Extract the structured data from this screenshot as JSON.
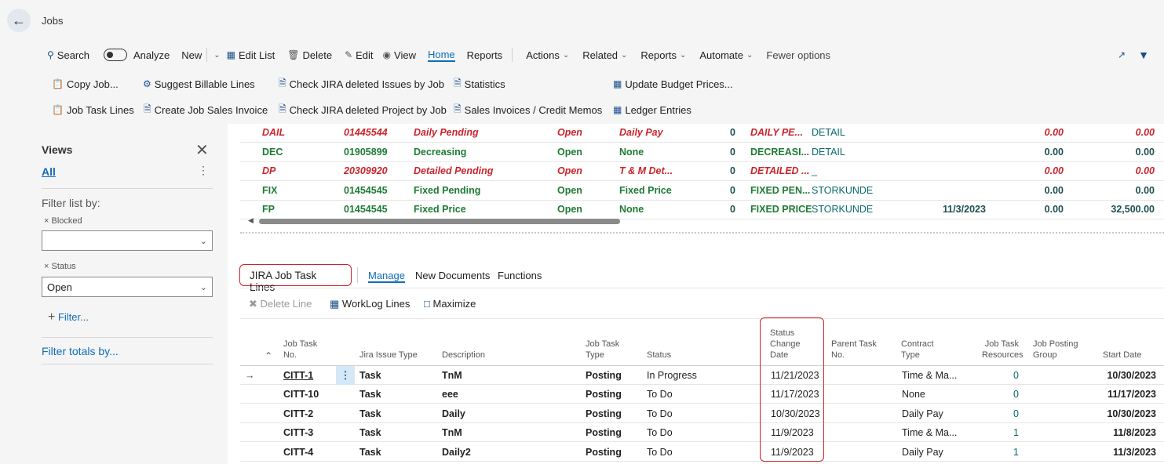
{
  "header": {
    "title": "Jobs",
    "back_icon": "arrow-left-icon"
  },
  "actionbar": {
    "row1": {
      "search": "Search",
      "analyze": "Analyze",
      "new": "New",
      "edit_list": "Edit List",
      "delete": "Delete",
      "edit": "Edit",
      "view": "View",
      "home": "Home",
      "reports": "Reports",
      "actions": "Actions",
      "related": "Related",
      "reports2": "Reports",
      "automate": "Automate",
      "fewer_options": "Fewer options"
    },
    "row2": {
      "copy_job": "Copy Job...",
      "suggest_billable": "Suggest Billable Lines",
      "check_jira_issues": "Check JIRA deleted Issues by Job",
      "statistics": "Statistics",
      "update_budget": "Update Budget Prices..."
    },
    "row3": {
      "job_task_lines": "Job Task Lines",
      "create_sales_invoice": "Create Job Sales Invoice",
      "check_jira_project": "Check JIRA deleted Project by Job",
      "sales_invoices": "Sales Invoices / Credit Memos",
      "ledger_entries": "Ledger Entries"
    }
  },
  "views": {
    "title": "Views",
    "all": "All",
    "filter_by": "Filter list by:",
    "blocked_label": "Blocked",
    "blocked_value": "",
    "status_label": "Status",
    "status_value": "Open",
    "add_filter": "Filter...",
    "filter_totals": "Filter totals by..."
  },
  "top_rows": [
    {
      "code": "DAIL",
      "num": "01445544",
      "desc": "Daily Pending",
      "status": "Open",
      "contract": "Daily Pay",
      "zero": "0",
      "desc2": "DAILY PE...",
      "cust": "DETAIL",
      "date": "",
      "v1": "0.00",
      "v2": "0.00",
      "style": "red"
    },
    {
      "code": "DEC",
      "num": "01905899",
      "desc": "Decreasing",
      "status": "Open",
      "contract": "None",
      "zero": "0",
      "desc2": "DECREASI...",
      "cust": "DETAIL",
      "date": "",
      "v1": "0.00",
      "v2": "0.00",
      "style": "green"
    },
    {
      "code": "DP",
      "num": "20309920",
      "desc": "Detailed Pending",
      "status": "Open",
      "contract": "T & M Det...",
      "zero": "0",
      "desc2": "DETAILED ...",
      "cust": "_",
      "date": "",
      "v1": "0.00",
      "v2": "0.00",
      "style": "red"
    },
    {
      "code": "FIX",
      "num": "01454545",
      "desc": "Fixed Pending",
      "status": "Open",
      "contract": "Fixed Price",
      "zero": "0",
      "desc2": "FIXED PEN...",
      "cust": "STORKUNDE",
      "date": "",
      "v1": "0.00",
      "v2": "0.00",
      "style": "green"
    },
    {
      "code": "FP",
      "num": "01454545",
      "desc": "Fixed Price",
      "status": "Open",
      "contract": "None",
      "zero": "0",
      "desc2": "FIXED PRICE",
      "cust": "STORKUNDE",
      "date": "11/3/2023",
      "v1": "0.00",
      "v2": "32,500.00",
      "style": "green"
    }
  ],
  "part": {
    "tab_title": "JIRA Job Task Lines",
    "manage": "Manage",
    "new_documents": "New Documents",
    "functions": "Functions",
    "delete_line": "Delete Line",
    "worklog_lines": "WorkLog Lines",
    "maximize": "Maximize"
  },
  "columns": {
    "job_task_no_1": "Job Task",
    "job_task_no_2": "No.",
    "jira_issue_type": "Jira Issue Type",
    "description": "Description",
    "job_task_type_1": "Job Task",
    "job_task_type_2": "Type",
    "status": "Status",
    "status_change_1": "Status",
    "status_change_2": "Change",
    "status_change_3": "Date",
    "parent_task_1": "Parent Task",
    "parent_task_2": "No.",
    "contract_1": "Contract",
    "contract_2": "Type",
    "resources_1": "Job Task",
    "resources_2": "Resources",
    "posting_group_1": "Job Posting",
    "posting_group_2": "Group",
    "start_date": "Start Date"
  },
  "task_rows": [
    {
      "no": "CITT-1",
      "type": "Task",
      "desc": "TnM",
      "task_type": "Posting",
      "status": "In Progress",
      "changed": "11/21/2023",
      "parent": "",
      "contract": "Time & Ma...",
      "res": "0",
      "group": "",
      "start": "10/30/2023"
    },
    {
      "no": "CITT-10",
      "type": "Task",
      "desc": "eee",
      "task_type": "Posting",
      "status": "To Do",
      "changed": "11/17/2023",
      "parent": "",
      "contract": "None",
      "res": "0",
      "group": "",
      "start": "11/17/2023"
    },
    {
      "no": "CITT-2",
      "type": "Task",
      "desc": "Daily",
      "task_type": "Posting",
      "status": "To Do",
      "changed": "10/30/2023",
      "parent": "",
      "contract": "Daily Pay",
      "res": "0",
      "group": "",
      "start": "10/30/2023"
    },
    {
      "no": "CITT-3",
      "type": "Task",
      "desc": "TnM",
      "task_type": "Posting",
      "status": "To Do",
      "changed": "11/9/2023",
      "parent": "",
      "contract": "Time & Ma...",
      "res": "1",
      "group": "",
      "start": "11/8/2023"
    },
    {
      "no": "CITT-4",
      "type": "Task",
      "desc": "Daily2",
      "task_type": "Posting",
      "status": "To Do",
      "changed": "11/9/2023",
      "parent": "",
      "contract": "Daily Pay",
      "res": "1",
      "group": "",
      "start": "11/3/2023"
    }
  ]
}
